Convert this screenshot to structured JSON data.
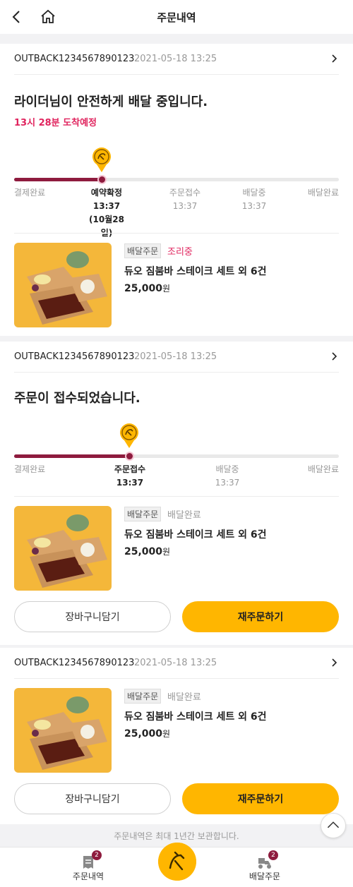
{
  "header": {
    "title": "주문내역"
  },
  "orders": [
    {
      "order_no": "OUTBACK1234567890123",
      "date": "2021-05-18 13:25",
      "status_title": "라이더님이 안전하게 배달 중입니다.",
      "eta": "13시 28분 도착예정",
      "progress": 0.27,
      "steps": [
        {
          "label": "결제완료",
          "time": "",
          "extra": ""
        },
        {
          "label": "예약확정",
          "time": "13:37",
          "extra": "(10월28일)"
        },
        {
          "label": "주문접수",
          "time": "13:37",
          "extra": ""
        },
        {
          "label": "배달중",
          "time": "13:37",
          "extra": ""
        },
        {
          "label": "배달완료",
          "time": "",
          "extra": ""
        }
      ],
      "badge": "배달주문",
      "state": "조리중",
      "product": "듀오 짐붐바 스테이크 세트 외 6건",
      "price": "25,000",
      "won": "원"
    },
    {
      "order_no": "OUTBACK1234567890123",
      "date": "2021-05-18 13:25",
      "status_title": "주문이 접수되었습니다.",
      "progress": 0.355,
      "steps": [
        {
          "label": "결제완료",
          "time": ""
        },
        {
          "label": "주문접수",
          "time": "13:37"
        },
        {
          "label": "배달중",
          "time": "13:37"
        },
        {
          "label": "배달완료",
          "time": ""
        }
      ],
      "badge": "배달주문",
      "state": "배달완료",
      "product": "듀오 짐붐바 스테이크 세트 외 6건",
      "price": "25,000",
      "won": "원",
      "cart_label": "장바구니담기",
      "reorder_label": "재주문하기"
    },
    {
      "order_no": "OUTBACK1234567890123",
      "date": "2021-05-18 13:25",
      "badge": "배달주문",
      "state": "배달완료",
      "product": "듀오 짐붐바 스테이크 세트 외 6건",
      "price": "25,000",
      "won": "원",
      "cart_label": "장바구니담기",
      "reorder_label": "재주문하기"
    }
  ],
  "keep_note": "주문내역은 최대 1년간 보관합니다.",
  "bottom_nav": {
    "orders_label": "주문내역",
    "orders_count": "2",
    "delivery_label": "배달주문",
    "delivery_count": "2"
  },
  "colors": {
    "accent": "#ffb600",
    "progress": "#8e1b3e",
    "alert": "#e0245e"
  }
}
